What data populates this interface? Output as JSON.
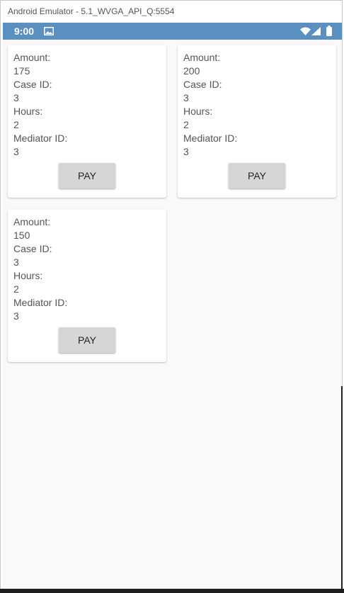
{
  "window": {
    "title": "Android Emulator - 5.1_WVGA_API_Q:5554"
  },
  "status_bar": {
    "time": "9:00"
  },
  "labels": {
    "amount": "Amount:",
    "case_id": "Case ID:",
    "hours": "Hours:",
    "mediator_id": "Mediator ID:",
    "pay": "PAY"
  },
  "payments": [
    {
      "amount": "175",
      "case_id": "3",
      "hours": "2",
      "mediator_id": "3"
    },
    {
      "amount": "200",
      "case_id": "3",
      "hours": "2",
      "mediator_id": "3"
    },
    {
      "amount": "150",
      "case_id": "3",
      "hours": "2",
      "mediator_id": "3"
    }
  ],
  "colors": {
    "status_bar": "#5b8fc0",
    "card_background": "#ffffff",
    "button_background": "#d6d6d6",
    "screen_background": "#f9f9f9"
  }
}
